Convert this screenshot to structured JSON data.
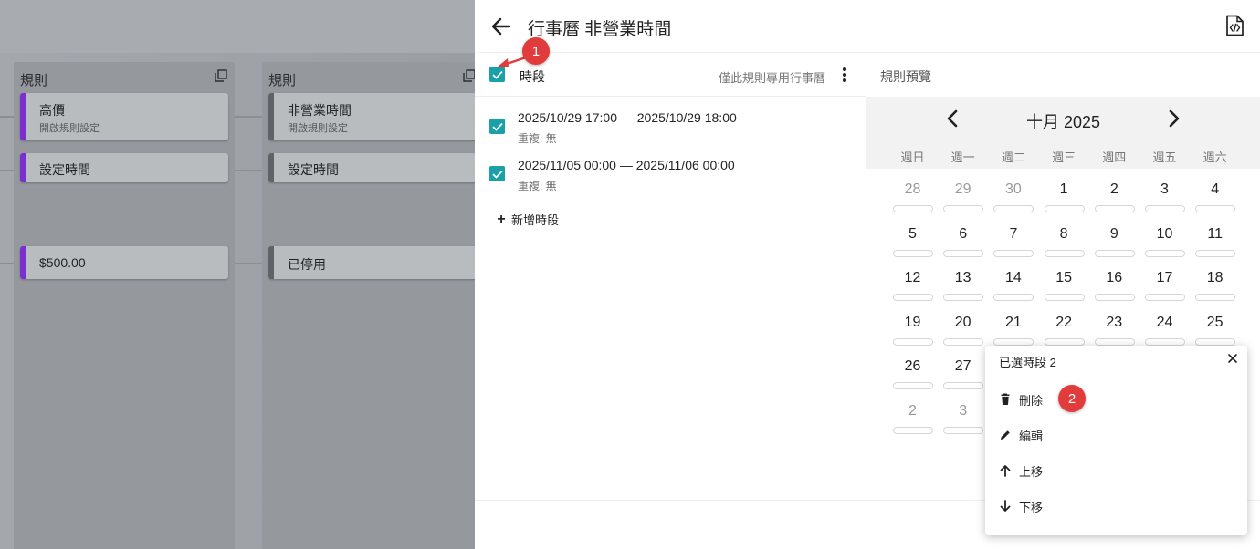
{
  "board": {
    "columns": [
      {
        "title": "規則",
        "cards": [
          {
            "title": "高價",
            "subtitle": "開啟規則設定",
            "accent": "#7b2fd0"
          },
          {
            "title": "設定時間",
            "accent": "#7b2fd0"
          },
          {
            "title": "$500.00",
            "accent": "#7b2fd0"
          }
        ]
      },
      {
        "title": "規則",
        "cards": [
          {
            "title": "非營業時間",
            "subtitle": "開啟規則設定",
            "accent": "#5f6368"
          },
          {
            "title": "設定時間",
            "accent": "#5f6368"
          },
          {
            "title": "已停用",
            "accent": "#5f6368"
          }
        ]
      }
    ]
  },
  "panel": {
    "title": "行事曆 非營業時間",
    "section_label": "時段",
    "section_note": "僅此規則專用行事曆",
    "periods": [
      {
        "range": "2025/10/29 17:00 — 2025/10/29 18:00",
        "repeat": "重複: 無"
      },
      {
        "range": "2025/11/05 00:00 — 2025/11/06 00:00",
        "repeat": "重複: 無"
      }
    ],
    "add_label": "新增時段",
    "preview_label": "規則預覽",
    "accent": "#19a0a8"
  },
  "calendar": {
    "month_label": "十月 2025",
    "weekdays": [
      "週日",
      "週一",
      "週二",
      "週三",
      "週四",
      "週五",
      "週六"
    ],
    "weeks": [
      [
        {
          "d": "28",
          "m": true
        },
        {
          "d": "29",
          "m": true
        },
        {
          "d": "30",
          "m": true
        },
        {
          "d": "1"
        },
        {
          "d": "2"
        },
        {
          "d": "3"
        },
        {
          "d": "4"
        }
      ],
      [
        {
          "d": "5"
        },
        {
          "d": "6"
        },
        {
          "d": "7"
        },
        {
          "d": "8"
        },
        {
          "d": "9"
        },
        {
          "d": "10"
        },
        {
          "d": "11"
        }
      ],
      [
        {
          "d": "12"
        },
        {
          "d": "13"
        },
        {
          "d": "14"
        },
        {
          "d": "15"
        },
        {
          "d": "16"
        },
        {
          "d": "17"
        },
        {
          "d": "18"
        }
      ],
      [
        {
          "d": "19"
        },
        {
          "d": "20"
        },
        {
          "d": "21"
        },
        {
          "d": "22"
        },
        {
          "d": "23"
        },
        {
          "d": "24"
        },
        {
          "d": "25"
        }
      ],
      [
        {
          "d": "26"
        },
        {
          "d": "27"
        }
      ],
      [
        {
          "d": "2",
          "m": true
        },
        {
          "d": "3",
          "m": true
        }
      ]
    ]
  },
  "popup": {
    "title": "已選時段 2",
    "items": [
      {
        "label": "刪除",
        "icon": "trash-icon"
      },
      {
        "label": "編輯",
        "icon": "pencil-icon"
      },
      {
        "label": "上移",
        "icon": "arrow-up-icon"
      },
      {
        "label": "下移",
        "icon": "arrow-down-icon"
      }
    ]
  },
  "annotations": {
    "badge_1": "1",
    "badge_2": "2",
    "badge_color": "#e23b3b"
  }
}
